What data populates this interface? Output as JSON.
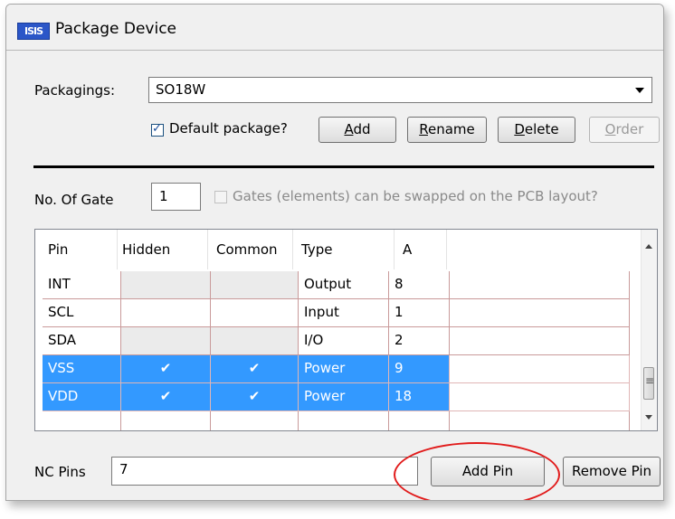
{
  "window": {
    "icon_text": "ISIS",
    "title": "Package Device"
  },
  "packagings": {
    "label": "Packagings:",
    "selected": "SO18W",
    "default_checkbox_label": "Default package?",
    "default_checked": true
  },
  "buttons": {
    "add": {
      "acc": "A",
      "rest": "dd"
    },
    "rename": {
      "acc": "R",
      "rest": "ename"
    },
    "delete": {
      "acc": "D",
      "rest": "elete"
    },
    "order": {
      "acc": "O",
      "rest": "rder"
    },
    "add_pin": "Add Pin",
    "remove_pin": "Remove Pin"
  },
  "gates": {
    "label": "No. Of Gate",
    "value": "1",
    "swap_label": "Gates (elements) can be swapped on the PCB layout?",
    "swap_checked": false
  },
  "grid": {
    "headers": [
      "Pin",
      "Hidden",
      "Common",
      "Type",
      "A"
    ],
    "rows": [
      {
        "pin": "INT",
        "hidden": "",
        "common": "",
        "type": "Output",
        "a": "8",
        "selected": false
      },
      {
        "pin": "SCL",
        "hidden": "",
        "common": "",
        "type": "Input",
        "a": "1",
        "selected": false
      },
      {
        "pin": "SDA",
        "hidden": "",
        "common": "",
        "type": "I/O",
        "a": "2",
        "selected": false
      },
      {
        "pin": "VSS",
        "hidden": "✔",
        "common": "✔",
        "type": "Power",
        "a": "9",
        "selected": true
      },
      {
        "pin": "VDD",
        "hidden": "✔",
        "common": "✔",
        "type": "Power",
        "a": "18",
        "selected": true
      }
    ]
  },
  "nc_pins": {
    "label": "NC Pins",
    "value": "7"
  },
  "colors": {
    "selection": "#3399ff",
    "highlight_circle": "#e11b1b"
  }
}
